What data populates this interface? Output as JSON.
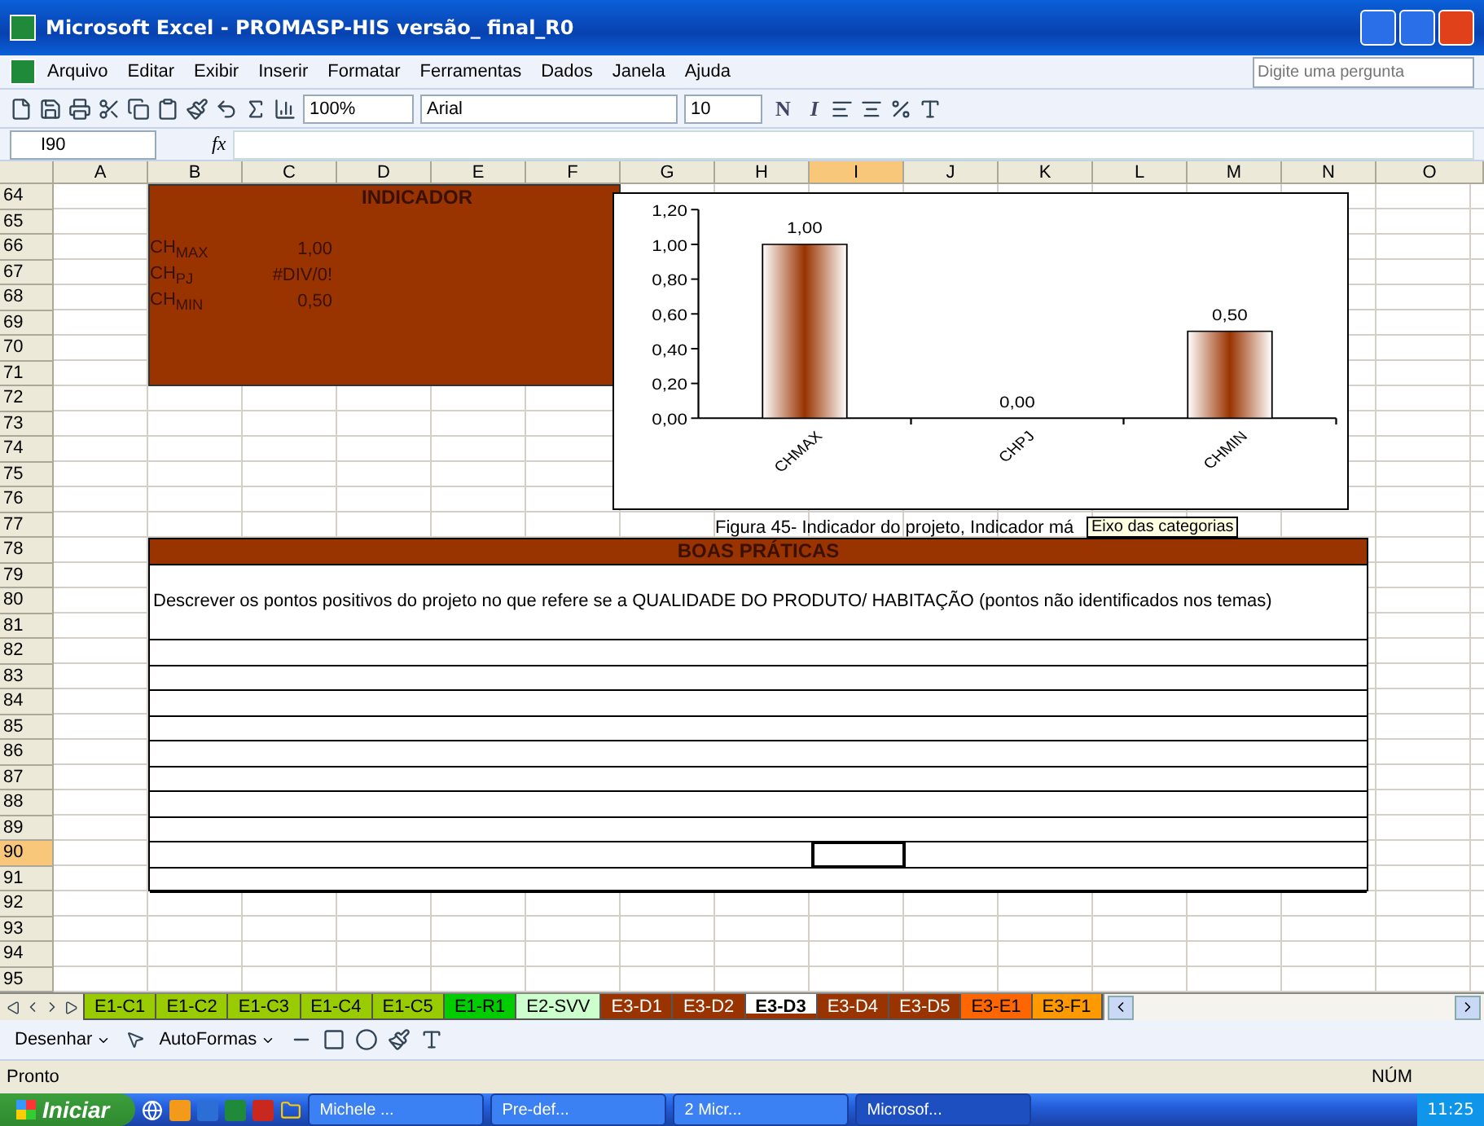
{
  "window": {
    "title": "Microsoft Excel - PROMASP-HIS versão_ final_R0"
  },
  "menu": [
    "Arquivo",
    "Editar",
    "Exibir",
    "Inserir",
    "Formatar",
    "Ferramentas",
    "Dados",
    "Janela",
    "Ajuda"
  ],
  "help_search": {
    "placeholder": "Digite uma pergunta"
  },
  "toolbar": {
    "zoom": "100%",
    "font": "Arial",
    "font_size": "10",
    "bold": "N",
    "italic": "I"
  },
  "formula_bar": {
    "name_box": "I90",
    "fx": "fx"
  },
  "columns": [
    "A",
    "B",
    "C",
    "D",
    "E",
    "F",
    "G",
    "H",
    "I",
    "J",
    "K",
    "L",
    "M",
    "N",
    "O"
  ],
  "rows": [
    "64",
    "65",
    "66",
    "67",
    "68",
    "69",
    "70",
    "71",
    "72",
    "73",
    "74",
    "75",
    "76",
    "77",
    "78",
    "79",
    "80",
    "81",
    "82",
    "83",
    "84",
    "85",
    "86",
    "87",
    "88",
    "89",
    "90",
    "91",
    "92",
    "93",
    "94",
    "95"
  ],
  "indicator": {
    "title": "INDICADOR",
    "items": [
      {
        "label": "CH$_{MAX}$",
        "value": "1,00"
      },
      {
        "label": "CH$_{PJ}$",
        "value": "#DIV/0!"
      },
      {
        "label": "CH$_{MIN}$",
        "value": "0,50"
      }
    ]
  },
  "chart": {
    "caption": "Figura 45- Indicador do projeto, Indicador má",
    "tooltip": "Eixo das categorias",
    "chart_data": {
      "type": "bar",
      "categories": [
        "CHMAX",
        "CHPJ",
        "CHMIN"
      ],
      "values": [
        1,
        0,
        0.5
      ],
      "ylim": [
        0,
        1.2
      ],
      "yticks": [
        {
          "value": 0,
          "label": "0,00"
        },
        {
          "value": 0.2,
          "label": "0,20"
        },
        {
          "value": 0.4,
          "label": "0,40"
        },
        {
          "value": 0.6,
          "label": "0,60"
        },
        {
          "value": 0.8,
          "label": "0,80"
        },
        {
          "value": 1,
          "label": "1,00"
        },
        {
          "value": 1.2,
          "label": "1,20"
        }
      ],
      "value_labels": [
        "1,00",
        "0,00",
        "0,50"
      ]
    }
  },
  "good_practices": {
    "title": "BOAS PRÁTICAS",
    "prompt": "Descrever os pontos positivos do projeto no que refere se a QUALIDADE DO PRODUTO/ HABITAÇÃO (pontos não identificados nos temas)"
  },
  "sheet_tabs": [
    {
      "label": "E1-C1",
      "color": "#99cc00",
      "selected": false
    },
    {
      "label": "E1-C2",
      "color": "#99cc00",
      "selected": false
    },
    {
      "label": "E1-C3",
      "color": "#99cc00",
      "selected": false
    },
    {
      "label": "E1-C4",
      "color": "#99cc00",
      "selected": false
    },
    {
      "label": "E1-C5",
      "color": "#99cc00",
      "selected": false
    },
    {
      "label": "E1-R1",
      "color": "#00cc00",
      "selected": false
    },
    {
      "label": "E2-SVV",
      "color": "#ccffcc",
      "selected": false
    },
    {
      "label": "E3-D1",
      "color": "#993300",
      "selected": false
    },
    {
      "label": "E3-D2",
      "color": "#993300",
      "selected": false
    },
    {
      "label": "E3-D3",
      "color": "#993300",
      "selected": true
    },
    {
      "label": "E3-D4",
      "color": "#993300",
      "selected": false
    },
    {
      "label": "E3-D5",
      "color": "#993300",
      "selected": false
    },
    {
      "label": "E3-E1",
      "color": "#ff6600",
      "selected": false
    },
    {
      "label": "E3-F1",
      "color": "#ff9900",
      "selected": false
    }
  ],
  "drawing_toolbar": {
    "draw": "Desenhar",
    "autoshapes": "AutoFormas"
  },
  "status_bar": {
    "status": "Pronto",
    "num": "NÚM"
  },
  "taskbar": {
    "start": "Iniciar",
    "tasks": [
      {
        "label": "Michele ...",
        "selected": false
      },
      {
        "label": "Pre-def...",
        "selected": false
      },
      {
        "label": "2 Micr...",
        "selected": false
      },
      {
        "label": "Microsof...",
        "selected": true
      }
    ],
    "time": "11:25"
  }
}
